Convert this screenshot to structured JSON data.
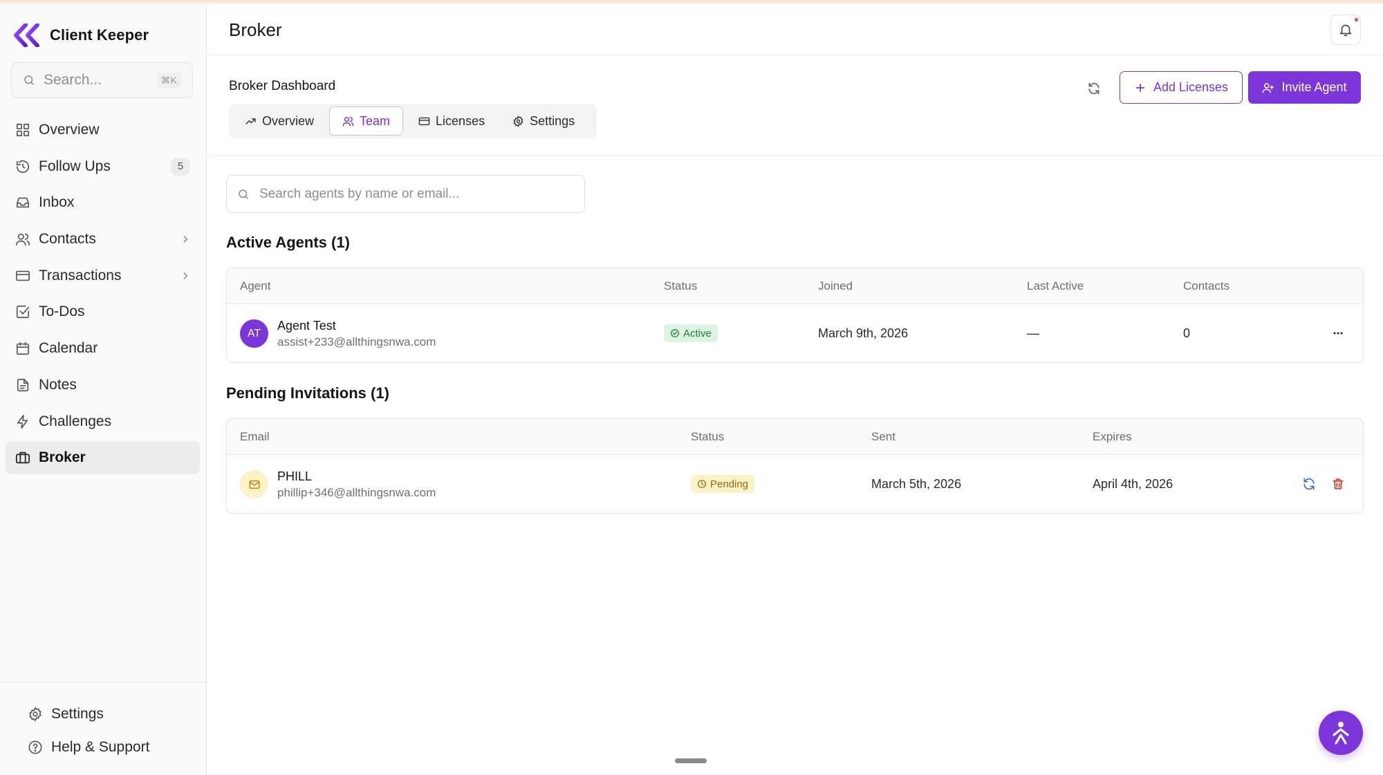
{
  "app": {
    "name": "Client Keeper",
    "brand_color": "#7b35d9"
  },
  "sidebar": {
    "search": {
      "placeholder": "Search...",
      "shortcut": "⌘K"
    },
    "items": [
      {
        "label": "Overview",
        "icon": "grid-icon"
      },
      {
        "label": "Follow Ups",
        "icon": "history-icon",
        "badge": "5"
      },
      {
        "label": "Inbox",
        "icon": "inbox-icon"
      },
      {
        "label": "Contacts",
        "icon": "users-icon",
        "has_submenu": true
      },
      {
        "label": "Transactions",
        "icon": "credit-card-icon",
        "has_submenu": true
      },
      {
        "label": "To-Dos",
        "icon": "checkbox-icon"
      },
      {
        "label": "Calendar",
        "icon": "calendar-icon"
      },
      {
        "label": "Notes",
        "icon": "document-icon"
      },
      {
        "label": "Challenges",
        "icon": "bolt-icon"
      },
      {
        "label": "Broker",
        "icon": "briefcase-icon",
        "active": true
      }
    ],
    "bottom": [
      {
        "label": "Settings",
        "icon": "gear-icon"
      },
      {
        "label": "Help & Support",
        "icon": "help-circle-icon"
      }
    ]
  },
  "header": {
    "title": "Broker",
    "notification_dot": true
  },
  "dashboard": {
    "title": "Broker Dashboard",
    "tabs": [
      {
        "label": "Overview",
        "icon": "trending-up-icon"
      },
      {
        "label": "Team",
        "icon": "users-icon",
        "active": true
      },
      {
        "label": "Licenses",
        "icon": "credit-card-icon"
      },
      {
        "label": "Settings",
        "icon": "gear-icon"
      }
    ],
    "add_licenses_label": "Add Licenses",
    "invite_agent_label": "Invite Agent"
  },
  "agent_search": {
    "placeholder": "Search agents by name or email...",
    "value": ""
  },
  "active_agents": {
    "title": "Active Agents (1)",
    "columns": [
      "Agent",
      "Status",
      "Joined",
      "Last Active",
      "Contacts"
    ],
    "rows": [
      {
        "initials": "AT",
        "name": "Agent Test",
        "email": "assist+233@allthingsnwa.com",
        "status": "Active",
        "joined": "March 9th, 2026",
        "last_active": "—",
        "contacts": "0"
      }
    ]
  },
  "pending_invitations": {
    "title": "Pending Invitations (1)",
    "columns": [
      "Email",
      "Status",
      "Sent",
      "Expires"
    ],
    "rows": [
      {
        "name": "PHILL",
        "email": "phillip+346@allthingsnwa.com",
        "status": "Pending",
        "sent": "March 5th, 2026",
        "expires": "April 4th, 2026"
      }
    ]
  },
  "colors": {
    "accent": "#7b35d9",
    "active_badge_bg": "#dcf5e3",
    "active_badge_text": "#1d7a3c",
    "pending_badge_bg": "#fdf1c8",
    "pending_badge_text": "#9a6a00",
    "resend_icon": "#2f6fe0",
    "delete_icon": "#d92d20"
  }
}
